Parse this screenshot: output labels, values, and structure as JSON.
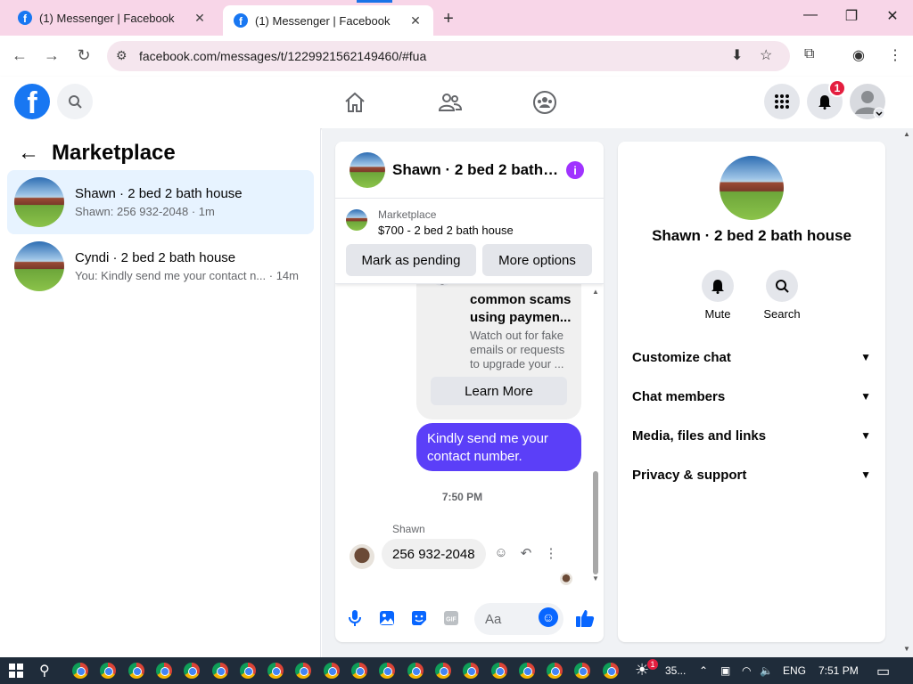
{
  "browser": {
    "tabs": [
      {
        "title": "(1) Messenger | Facebook"
      },
      {
        "title": "(1) Messenger | Facebook"
      }
    ],
    "url": "facebook.com/messages/t/1229921562149460/#fua"
  },
  "header": {
    "notification_count": "1"
  },
  "sidebar": {
    "title": "Marketplace",
    "conversations": [
      {
        "name": "Shawn · 2 bed 2 bath house",
        "preview": "Shawn: 256 932-2048 · 1m"
      },
      {
        "name": "Cyndi · 2 bed 2 bath house",
        "preview": "You: Kindly send me your contact n...  · 14m"
      }
    ]
  },
  "chat": {
    "title": "Shawn · 2 bed 2 bath house",
    "marketplace": {
      "label": "Marketplace",
      "listing": "$700 - 2 bed 2 bath house",
      "mark_pending": "Mark as pending",
      "more_options": "More options"
    },
    "scam_card": {
      "title": "common scams using paymen...",
      "desc": "Watch out for fake emails or requests to upgrade your ...",
      "button": "Learn More"
    },
    "outgoing_message": "Kindly send me your contact number.",
    "timestamp": "7:50 PM",
    "sender": "Shawn",
    "incoming_message": "256 932-2048",
    "composer_placeholder": "Aa"
  },
  "info_panel": {
    "name": "Shawn · 2 bed 2 bath house",
    "actions": [
      {
        "label": "Mute",
        "icon": "bell-icon"
      },
      {
        "label": "Search",
        "icon": "search-icon"
      }
    ],
    "sections": [
      "Customize chat",
      "Chat members",
      "Media, files and links",
      "Privacy & support"
    ]
  },
  "taskbar": {
    "weather": "35...",
    "language": "ENG",
    "time": "7:51 PM",
    "weather_badge": "1"
  },
  "colors": {
    "facebook_blue": "#1877f2",
    "messenger_purple": "#5b3ff8",
    "tab_strip": "#f8d6e8"
  }
}
